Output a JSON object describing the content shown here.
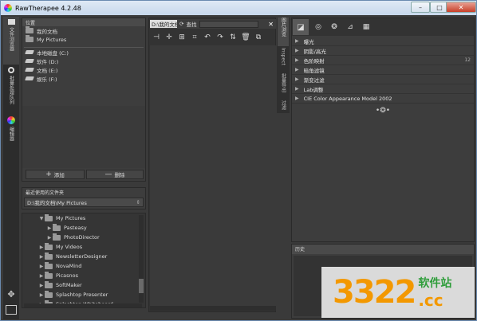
{
  "window": {
    "title": "RawTherapee 4.2.48"
  },
  "left_tabs": [
    {
      "label": "文件浏览器"
    },
    {
      "label": "批量处理队列"
    },
    {
      "label": "编辑器"
    }
  ],
  "places": {
    "header": "位置",
    "items": [
      {
        "label": "我的文档",
        "icon": "folder"
      },
      {
        "label": "My Pictures",
        "icon": "folder"
      },
      {
        "label": "本地磁盘 (C:)",
        "icon": "drive"
      },
      {
        "label": "软件 (D:)",
        "icon": "drive"
      },
      {
        "label": "文档 (E:)",
        "icon": "drive"
      },
      {
        "label": "娱乐 (F:)",
        "icon": "drive"
      }
    ],
    "add_label": "添加",
    "remove_label": "删除"
  },
  "recent": {
    "header": "最近使用的文件夹",
    "value": "D:\\我的文档\\My Pictures"
  },
  "tree": [
    {
      "label": "My Pictures",
      "level": 0,
      "expanded": true
    },
    {
      "label": "Pasteasy",
      "level": 1
    },
    {
      "label": "PhotoDirector",
      "level": 1
    },
    {
      "label": "My Videos",
      "level": 0
    },
    {
      "label": "NewsletterDesigner",
      "level": 0
    },
    {
      "label": "NovaMind",
      "level": 0
    },
    {
      "label": "Picasnos",
      "level": 0
    },
    {
      "label": "SoftMaker",
      "level": 0
    },
    {
      "label": "Splashtop Presenter",
      "level": 0
    },
    {
      "label": "Splashtop Whiteboard",
      "level": 0
    }
  ],
  "browser": {
    "path": "D:\\我的文档",
    "find_label": "查找",
    "find_placeholder": ""
  },
  "middle_tabs": [
    {
      "label": "图片浏览"
    },
    {
      "label": "Inspect"
    },
    {
      "label": "批量导出"
    },
    {
      "label": "过滤"
    }
  ],
  "tools": {
    "rows": [
      {
        "label": "曝光"
      },
      {
        "label": "阴影/高光"
      },
      {
        "label": "色阶映射",
        "num": "12"
      },
      {
        "label": "暗角滤镜"
      },
      {
        "label": "渐变过滤"
      },
      {
        "label": "Lab调整"
      },
      {
        "label": "CIE Color Appearance Model 2002"
      }
    ]
  },
  "history": {
    "header": "历史"
  },
  "watermark": {
    "brand_text": "3322",
    "site_text": "软件站",
    "suffix": ".cc"
  },
  "colors": {
    "bg": "#3a3a3a",
    "panel": "#3d3d3d",
    "title_gradient_top": "#dfe9f5",
    "watermark_orange": "#f39800",
    "watermark_green": "#2e9d3a"
  }
}
